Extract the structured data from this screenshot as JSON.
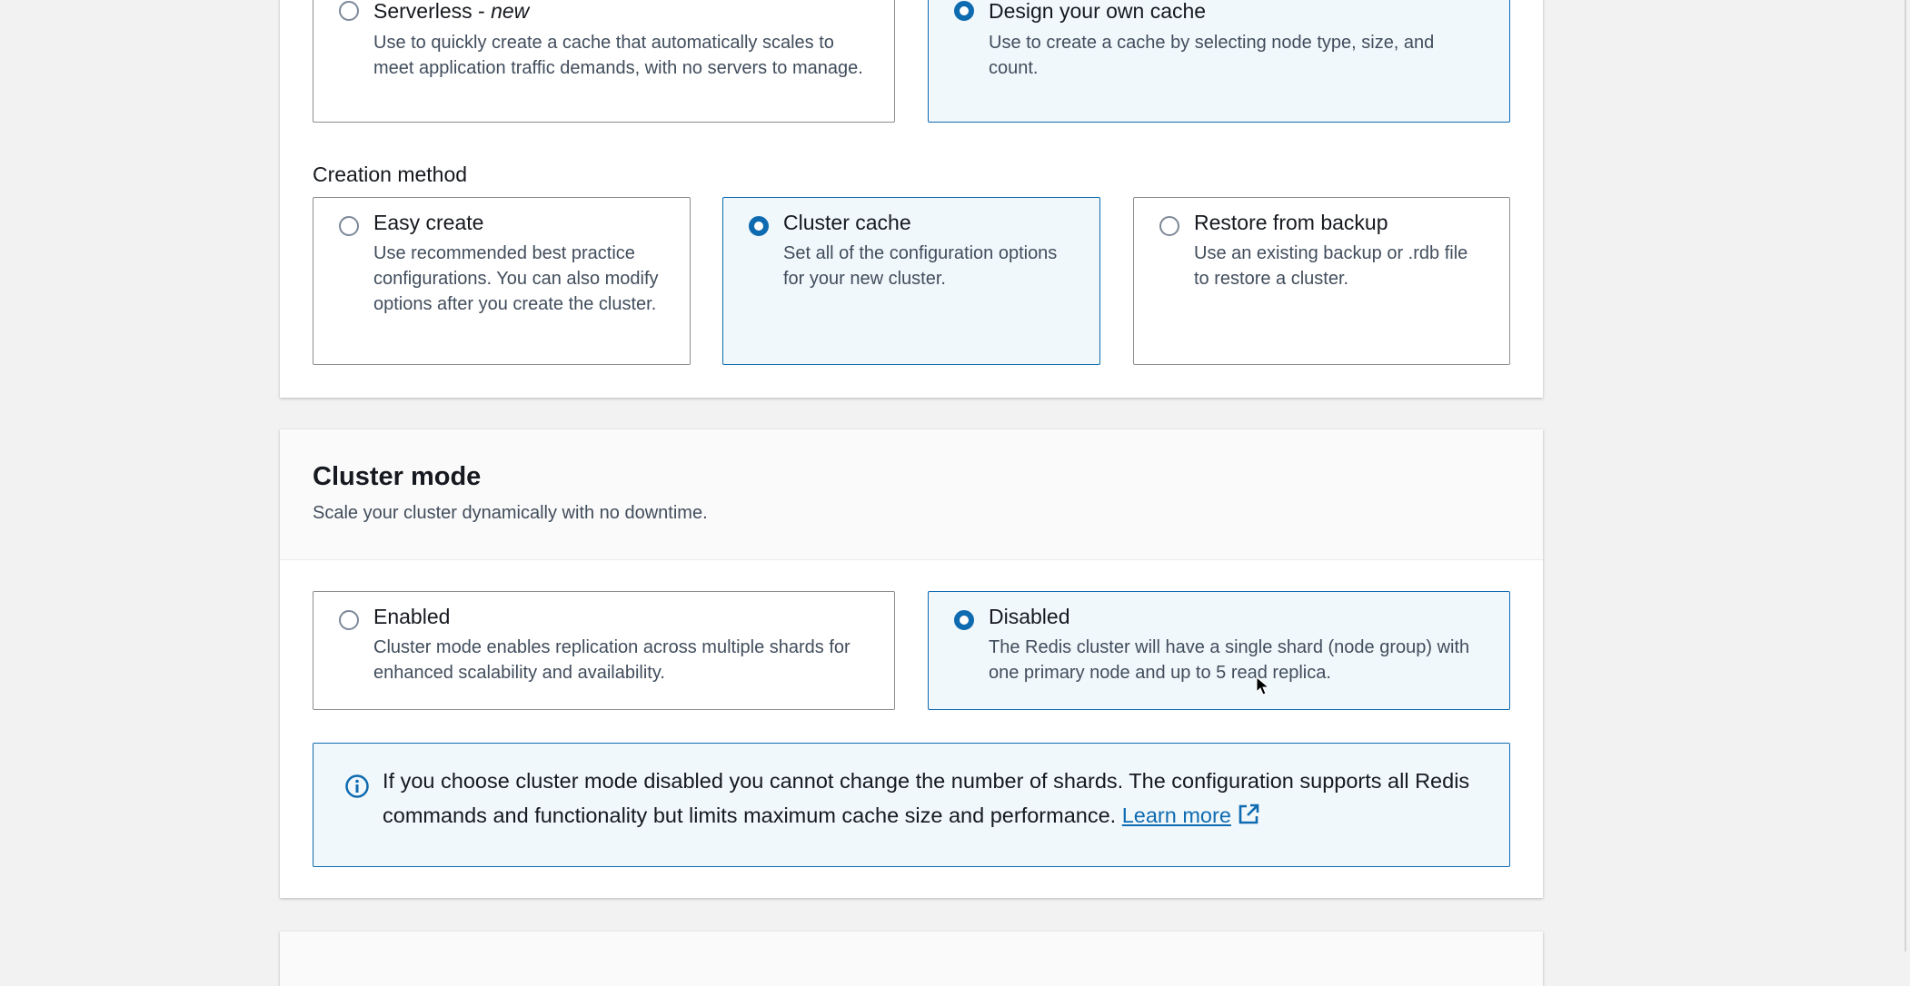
{
  "deployment": {
    "options": [
      {
        "title": "Serverless - ",
        "title_em": "new",
        "description": "Use to quickly create a cache that automatically scales to meet application traffic demands, with no servers to manage.",
        "selected": false
      },
      {
        "title": "Design your own cache",
        "description": "Use to create a cache by selecting node type, size, and count.",
        "selected": true
      }
    ]
  },
  "creation_method": {
    "label": "Creation method",
    "options": [
      {
        "title": "Easy create",
        "description": "Use recommended best practice configurations. You can also modify options after you create the cluster.",
        "selected": false
      },
      {
        "title": "Cluster cache",
        "description": "Set all of the configuration options for your new cluster.",
        "selected": true
      },
      {
        "title": "Restore from backup",
        "description": "Use an existing backup or .rdb file to restore a cluster.",
        "selected": false
      }
    ]
  },
  "cluster_mode": {
    "title": "Cluster mode",
    "subtitle": "Scale your cluster dynamically with no downtime.",
    "options": [
      {
        "title": "Enabled",
        "description": "Cluster mode enables replication across multiple shards for enhanced scalability and availability.",
        "selected": false
      },
      {
        "title": "Disabled",
        "description": "The Redis cluster will have a single shard (node group) with one primary node and up to 5 read replica.",
        "selected": true
      }
    ],
    "info": {
      "text": "If you choose cluster mode disabled you cannot change the number of shards. The configuration supports all Redis commands and functionality but limits maximum cache size and performance. ",
      "link": "Learn more"
    }
  },
  "colors": {
    "accent": "#0f6bb0",
    "selected_bg": "#f1f8fc"
  }
}
